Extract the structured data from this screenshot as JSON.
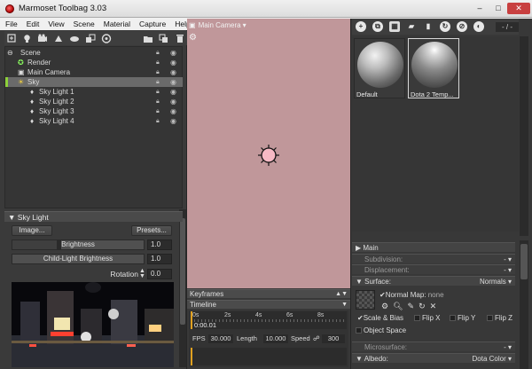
{
  "window": {
    "title": "Marmoset Toolbag 3.03",
    "minimize_glyph": "–",
    "maximize_glyph": "□",
    "close_glyph": "✕"
  },
  "menu": [
    "File",
    "Edit",
    "View",
    "Scene",
    "Material",
    "Capture",
    "Help"
  ],
  "scene": {
    "items": [
      {
        "label": "Scene",
        "indent": 0,
        "icon": "scene-icon",
        "selected": false
      },
      {
        "label": "Render",
        "indent": 1,
        "icon": "render-icon",
        "selected": false
      },
      {
        "label": "Main Camera",
        "indent": 1,
        "icon": "camera-icon",
        "selected": false
      },
      {
        "label": "Sky",
        "indent": 1,
        "icon": "sky-icon",
        "selected": true
      },
      {
        "label": "Sky Light 1",
        "indent": 2,
        "icon": "light-icon",
        "selected": false
      },
      {
        "label": "Sky Light 2",
        "indent": 2,
        "icon": "light-icon",
        "selected": false
      },
      {
        "label": "Sky Light 3",
        "indent": 2,
        "icon": "light-icon",
        "selected": false
      },
      {
        "label": "Sky Light 4",
        "indent": 2,
        "icon": "light-icon",
        "selected": false
      }
    ]
  },
  "sky_light": {
    "header": "Sky Light",
    "image_button": "Image...",
    "presets_button": "Presets...",
    "brightness_label": "Brightness",
    "brightness_value": "1.0",
    "child_brightness_label": "Child-Light Brightness",
    "child_brightness_value": "1.0",
    "rotation_label": "Rotation",
    "rotation_value": "0.0"
  },
  "viewport": {
    "camera_label": "Main Camera",
    "dropdown_glyph": "▾",
    "background_color": "#c0979a"
  },
  "timeline": {
    "keyframes_label": "Keyframes",
    "timeline_label": "Timeline",
    "ticks": [
      "0s",
      "2s",
      "4s",
      "6s",
      "8s"
    ],
    "current_time": "0:00.01",
    "fps_label": "FPS",
    "fps_value": "30.000",
    "length_label": "Length",
    "length_value": "10.000",
    "speed_label": "Speed",
    "speed_value": "300"
  },
  "materials": {
    "zoom_field": "- / -",
    "items": [
      {
        "name": "Default",
        "selected": false
      },
      {
        "name": "Dota 2 Temp...",
        "selected": true
      }
    ]
  },
  "properties": {
    "main_label": "Main",
    "subdivision_label": "Subdivision:",
    "displacement_label": "Displacement:",
    "surface_label": "Surface:",
    "surface_value": "Normals",
    "normal_map_label": "Normal Map:",
    "normal_map_value": "none",
    "scale_bias_label": "Scale & Bias",
    "flip_x_label": "Flip X",
    "flip_y_label": "Flip Y",
    "flip_z_label": "Flip Z",
    "object_space_label": "Object Space",
    "microsurface_label": "Microsurface:",
    "albedo_label": "Albedo:",
    "albedo_value": "Dota Color"
  }
}
